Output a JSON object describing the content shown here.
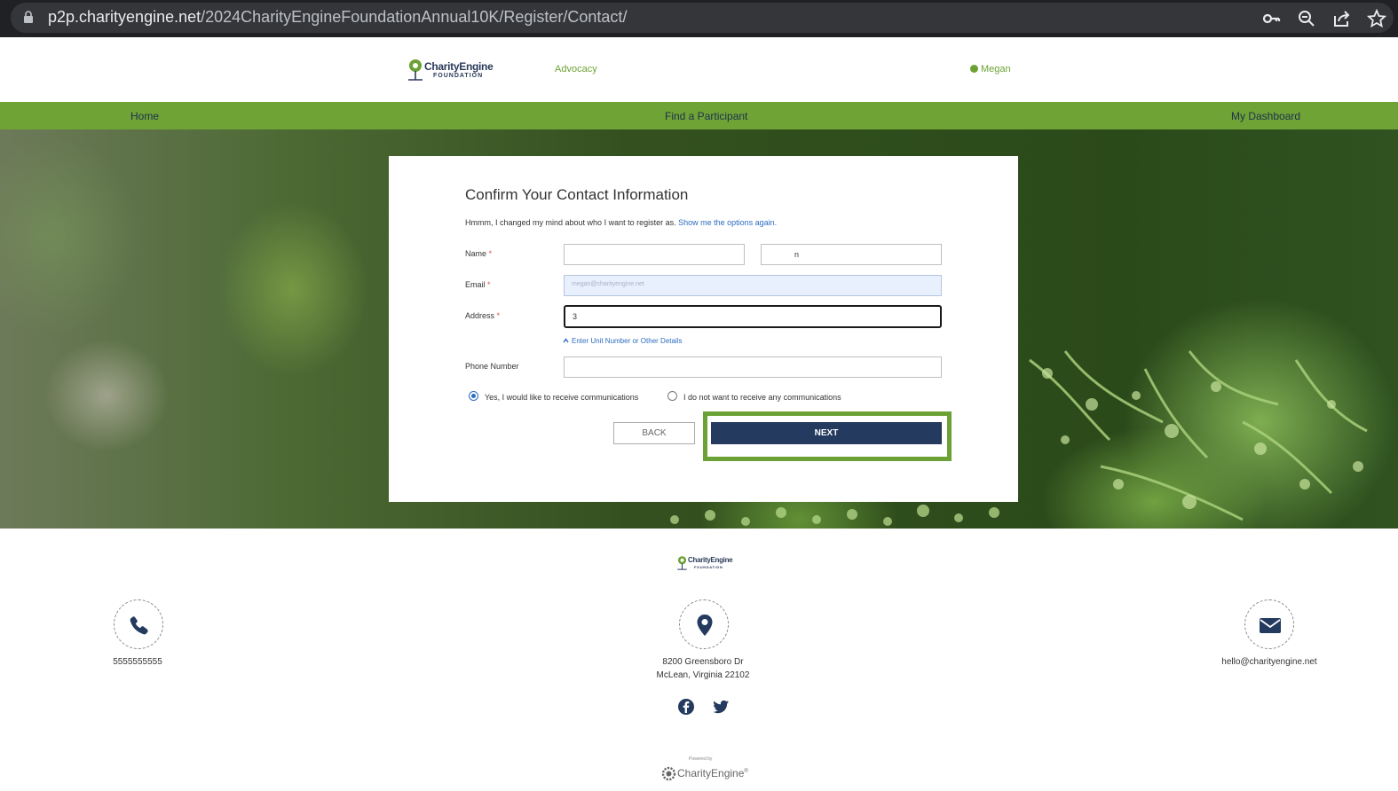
{
  "browser": {
    "url_host": "p2p.charityengine.net",
    "url_path": "/2024CharityEngineFoundationAnnual10K/Register/Contact/",
    "icons": [
      "lock-icon",
      "key-icon",
      "zoom-icon",
      "share-icon",
      "bookmark-star-icon"
    ]
  },
  "header": {
    "logo_line1": "CharityEngine",
    "logo_line2": "FOUNDATION",
    "advocacy_link": "Advocacy",
    "user_name": "Megan"
  },
  "nav": {
    "home": "Home",
    "find_participant": "Find a Participant",
    "dashboard": "My Dashboard"
  },
  "form": {
    "title": "Confirm Your Contact Information",
    "note_text": "Hmmm, I changed my mind about who I want to register as. ",
    "note_link": "Show me the options again.",
    "name_label": "Name",
    "name_first_value": "",
    "name_last_value": "n",
    "email_label": "Email",
    "email_value": "megan@charityengine.net",
    "address_label": "Address",
    "address_value": "3",
    "unit_link": "Enter Unit Number or Other Details",
    "phone_label": "Phone Number",
    "phone_value": "",
    "required_marker": "*",
    "comm_yes": "Yes, I would like to receive communications",
    "comm_no": "I do not want to receive any communications",
    "comm_selected": "yes",
    "back_button": "BACK",
    "next_button": "NEXT"
  },
  "footer": {
    "logo_line1": "CharityEngine",
    "logo_line2": "FOUNDATION",
    "phone": "5555555555",
    "address_line1": "8200 Greensboro Dr",
    "address_line2": "McLean, Virginia 22102",
    "email": "hello@charityengine.net",
    "powered_by": "Powered by",
    "powered_brand": "CharityEngine",
    "powered_mark": "®"
  },
  "colors": {
    "brand_green": "#6fa335",
    "navy": "#243a5e",
    "link_blue": "#2d6cc0"
  }
}
